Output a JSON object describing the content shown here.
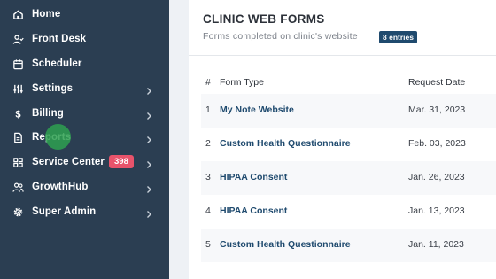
{
  "sidebar": {
    "items": [
      {
        "label": "Home",
        "icon": "home-icon",
        "chevron": false
      },
      {
        "label": "Front Desk",
        "icon": "user-check-icon",
        "chevron": false
      },
      {
        "label": "Scheduler",
        "icon": "calendar-icon",
        "chevron": false
      },
      {
        "label": "Settings",
        "icon": "sliders-icon",
        "chevron": true
      },
      {
        "label": "Billing",
        "icon": "dollar-icon",
        "chevron": true
      },
      {
        "label": "Reports",
        "icon": "document-icon",
        "chevron": true
      },
      {
        "label": "Service Center",
        "icon": "grid-icon",
        "chevron": true,
        "badge": "398"
      },
      {
        "label": "GrowthHub",
        "icon": "users-icon",
        "chevron": true
      },
      {
        "label": "Super Admin",
        "icon": "gear-icon",
        "chevron": true
      }
    ]
  },
  "main": {
    "title": "CLINIC WEB FORMS",
    "subtitle": "Forms completed on clinic's website",
    "entries_badge": "8 entries",
    "columns": [
      "#",
      "Form Type",
      "Request Date"
    ],
    "rows": [
      {
        "num": "1",
        "type": "My Note Website",
        "date": "Mar. 31, 2023"
      },
      {
        "num": "2",
        "type": "Custom Health Questionnaire",
        "date": "Feb. 03, 2023"
      },
      {
        "num": "3",
        "type": "HIPAA Consent",
        "date": "Jan. 26, 2023"
      },
      {
        "num": "4",
        "type": "HIPAA Consent",
        "date": "Jan. 13, 2023"
      },
      {
        "num": "5",
        "type": "Custom Health Questionnaire",
        "date": "Jan. 11, 2023"
      }
    ]
  },
  "colors": {
    "sidebar": "#2b3e52",
    "accent": "#1f4a6e",
    "badge": "#e8536b",
    "cursor": "#2ea050"
  }
}
